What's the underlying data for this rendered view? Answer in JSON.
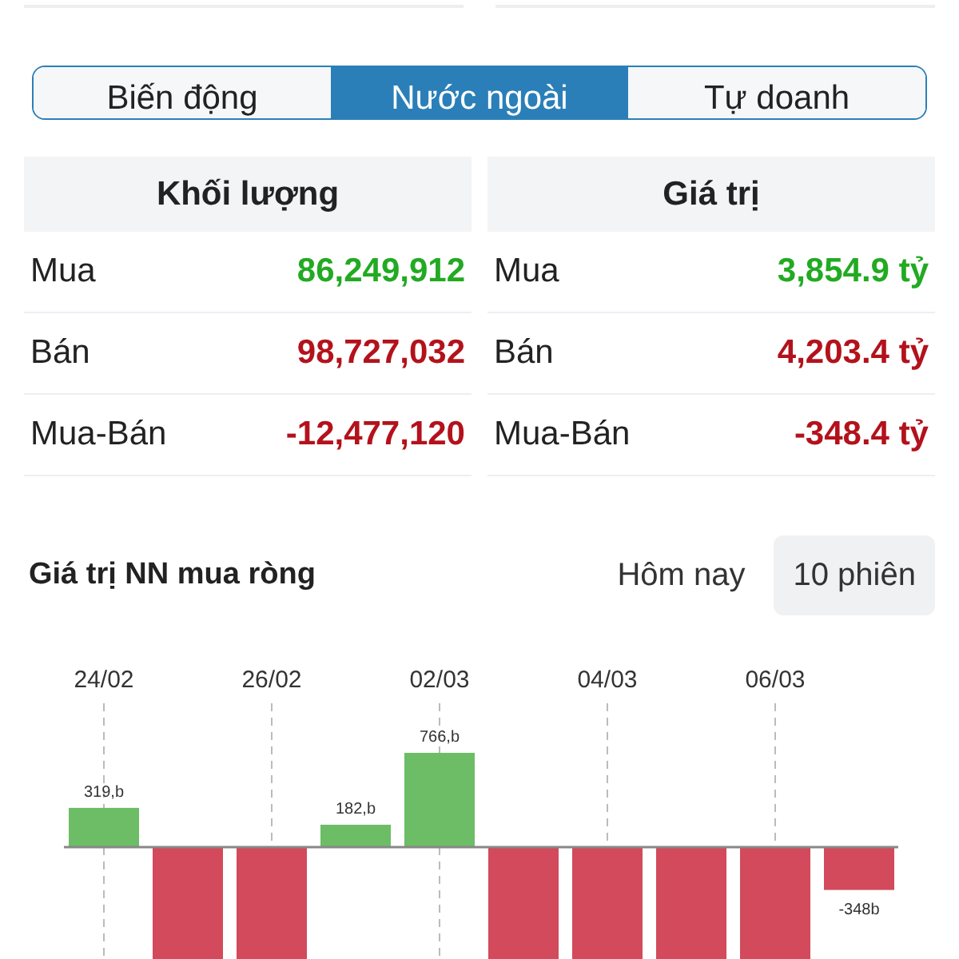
{
  "tabs": [
    {
      "label": "Biến động",
      "selected": false
    },
    {
      "label": "Nước ngoài",
      "selected": true
    },
    {
      "label": "Tự doanh",
      "selected": false
    }
  ],
  "tables": [
    {
      "header": "Khối lượng",
      "rows": [
        {
          "label": "Mua",
          "value": "86,249,912",
          "kind": "buy"
        },
        {
          "label": "Bán",
          "value": "98,727,032",
          "kind": "sell"
        },
        {
          "label": "Mua-Bán",
          "value": "-12,477,120",
          "kind": "sell"
        }
      ]
    },
    {
      "header": "Giá trị",
      "rows": [
        {
          "label": "Mua",
          "value": "3,854.9 tỷ",
          "kind": "buy"
        },
        {
          "label": "Bán",
          "value": "4,203.4 tỷ",
          "kind": "sell"
        },
        {
          "label": "Mua-Bán",
          "value": "-348.4 tỷ",
          "kind": "sell"
        }
      ]
    }
  ],
  "section": {
    "title": "Giá trị NN mua ròng",
    "periods": [
      {
        "label": "Hôm nay",
        "selected": false
      },
      {
        "label": "10 phiên",
        "selected": true
      }
    ]
  },
  "chart": {
    "date_labels": [
      "24/02",
      "26/02",
      "02/03",
      "04/03",
      "06/03"
    ],
    "bars": [
      {
        "kind": "up",
        "label": "319,b"
      },
      {
        "kind": "down"
      },
      {
        "kind": "down"
      },
      {
        "kind": "up",
        "label": "182,b"
      },
      {
        "kind": "up",
        "label": "766,b"
      },
      {
        "kind": "down"
      },
      {
        "kind": "down"
      },
      {
        "kind": "down"
      },
      {
        "kind": "down"
      },
      {
        "kind": "down",
        "label": "-348b"
      }
    ]
  }
}
